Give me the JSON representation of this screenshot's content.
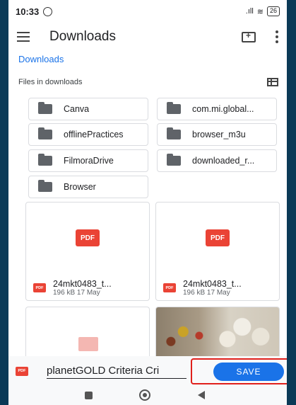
{
  "status_bar": {
    "time": "10:33",
    "signal": ".ıll",
    "battery": "26"
  },
  "app_bar": {
    "title": "Downloads"
  },
  "breadcrumb": "Downloads",
  "section": {
    "title": "Files in downloads"
  },
  "folders": [
    {
      "label": "Canva"
    },
    {
      "label": "com.mi.global..."
    },
    {
      "label": "offlinePractices"
    },
    {
      "label": "browser_m3u"
    },
    {
      "label": "FilmoraDrive"
    },
    {
      "label": "downloaded_r..."
    },
    {
      "label": "Browser"
    }
  ],
  "files": [
    {
      "badge": "PDF",
      "small_badge": "PDF",
      "name": "24mkt0483_t...",
      "info": "196 kB 17 May"
    },
    {
      "badge": "PDF",
      "small_badge": "PDF",
      "name": "24mkt0483_t...",
      "info": "196 kB 17 May"
    }
  ],
  "save_bar": {
    "file_icon_label": "PDF",
    "filename_value": "planetGOLD Criteria Cri",
    "save_label": "SAVE"
  },
  "colors": {
    "accent": "#1a73e8",
    "pdf_red": "#ea4335",
    "highlight": "#e0201b"
  }
}
